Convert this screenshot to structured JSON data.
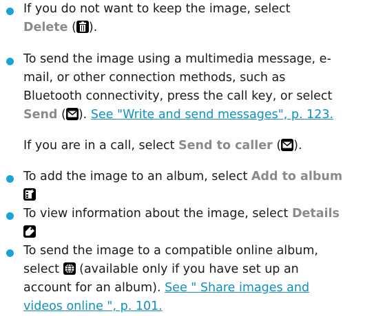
{
  "items": [
    {
      "lines": [
        [
          "If you do not want to keep the image, select"
        ],
        [
          "Delete",
          " (",
          "icon:trash",
          ")."
        ]
      ]
    },
    {
      "lines": [
        [
          "To send the image using a multimedia message, e-"
        ],
        [
          "mail, or other connection methods, such as"
        ],
        [
          "Bluetooth connectivity, press the call key, or select"
        ],
        [
          "Send",
          " (",
          "icon:envelope",
          "). ",
          "See \"Write and send messages\", p. 123."
        ]
      ],
      "subline": [
        "If you are in a call, select ",
        "Send to caller",
        " (",
        "icon:envelope",
        ")."
      ]
    },
    {
      "lines": [
        [
          "To add the image to an album, select ",
          "Add to album"
        ],
        [
          "icon:album"
        ]
      ]
    },
    {
      "lines": [
        [
          "To view information about the image, select ",
          "Details"
        ],
        [
          "icon:tag"
        ]
      ]
    },
    {
      "lines": [
        [
          "To send the image to a compatible online album,"
        ],
        [
          "select ",
          "icon:globe",
          " (available only if you have set up an"
        ],
        [
          "account for an album). ",
          "See \" Share images and"
        ],
        [
          "videos online \", p. 101."
        ]
      ]
    }
  ],
  "colors": {
    "bullet": "#1aa3d6",
    "keyword": "#8a8a8a",
    "link": "#0f8fc4",
    "text": "#1a1a1a"
  }
}
